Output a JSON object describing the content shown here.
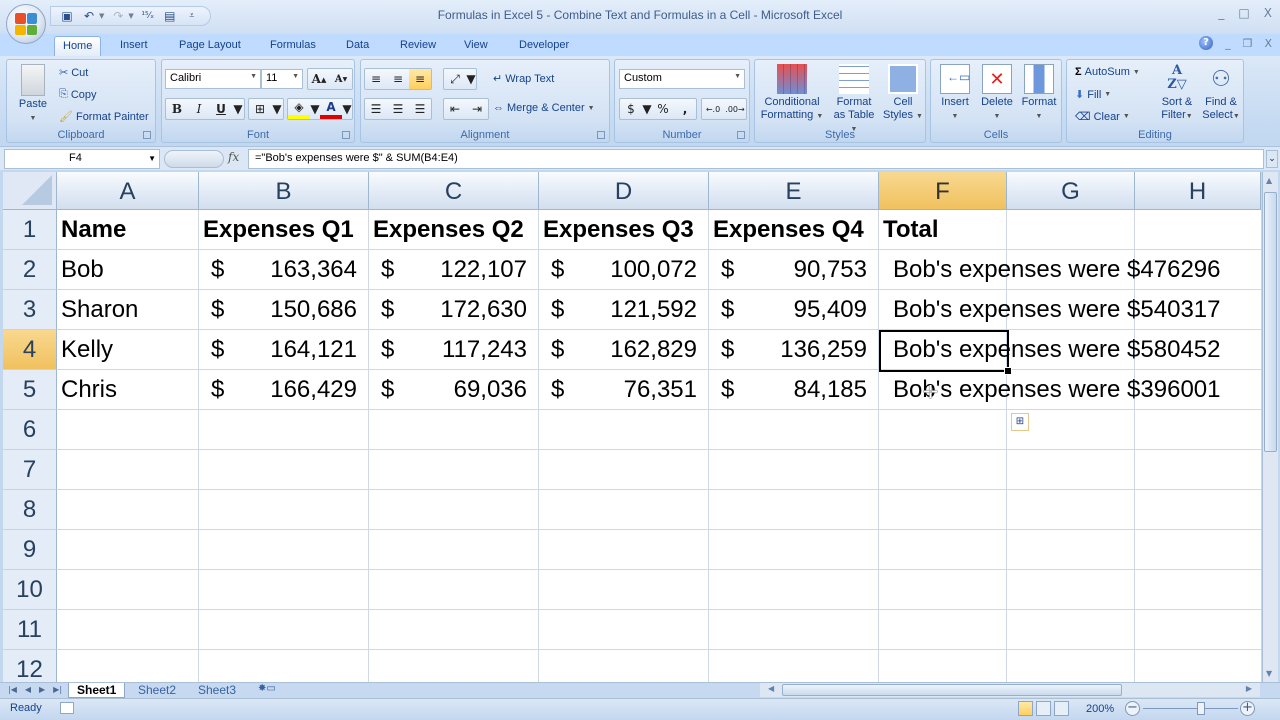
{
  "window": {
    "title": "Formulas in Excel 5 - Combine Text and Formulas in a Cell - Microsoft Excel",
    "controls": [
      "minimize",
      "maximize",
      "close"
    ]
  },
  "quick_access": [
    "save-icon",
    "undo-icon",
    "redo-icon",
    "spelling-icon",
    "print-preview-icon",
    "customize-icon"
  ],
  "tabs": [
    {
      "label": "Home",
      "active": true
    },
    {
      "label": "Insert"
    },
    {
      "label": "Page Layout"
    },
    {
      "label": "Formulas"
    },
    {
      "label": "Data"
    },
    {
      "label": "Review"
    },
    {
      "label": "View"
    },
    {
      "label": "Developer"
    }
  ],
  "ribbon": {
    "clipboard": {
      "label": "Clipboard",
      "paste": "Paste",
      "cut": "Cut",
      "copy": "Copy",
      "format_painter": "Format Painter"
    },
    "font": {
      "label": "Font",
      "font_name": "Calibri",
      "font_size": "11",
      "bold": "B",
      "italic": "I",
      "underline": "U"
    },
    "alignment": {
      "label": "Alignment",
      "wrap_text": "Wrap Text",
      "merge_center": "Merge & Center"
    },
    "number": {
      "label": "Number",
      "format": "Custom",
      "currency": "$",
      "percent": "%",
      "comma": ","
    },
    "styles": {
      "label": "Styles",
      "conditional": [
        "Conditional",
        "Formatting"
      ],
      "format_table": [
        "Format",
        "as Table"
      ],
      "cell_styles": [
        "Cell",
        "Styles"
      ]
    },
    "cells": {
      "label": "Cells",
      "insert": "Insert",
      "delete": "Delete",
      "format": "Format"
    },
    "editing": {
      "label": "Editing",
      "autosum": "AutoSum",
      "fill": "Fill",
      "clear": "Clear",
      "sort_filter": [
        "Sort &",
        "Filter"
      ],
      "find_select": [
        "Find &",
        "Select"
      ]
    }
  },
  "formula_bar": {
    "name_box": "F4",
    "fx": "fx",
    "formula": "=\"Bob's expenses were $\" & SUM(B4:E4)"
  },
  "sheet": {
    "columns": [
      "A",
      "B",
      "C",
      "D",
      "E",
      "F",
      "G",
      "H"
    ],
    "selected_column": "F",
    "rows": [
      "1",
      "2",
      "3",
      "4",
      "5",
      "6",
      "7",
      "8",
      "9",
      "10",
      "11",
      "12"
    ],
    "selected_row": "4",
    "active_cell": "F4",
    "headers": [
      "Name",
      "Expenses Q1",
      "Expenses Q2",
      "Expenses Q3",
      "Expenses Q4",
      "Total"
    ],
    "currency_symbol": "$",
    "data": [
      {
        "name": "Bob",
        "q1": "163,364",
        "q2": "122,107",
        "q3": "100,072",
        "q4": "90,753",
        "total": "Bob's expenses were $476296"
      },
      {
        "name": "Sharon",
        "q1": "150,686",
        "q2": "172,630",
        "q3": "121,592",
        "q4": "95,409",
        "total": "Bob's expenses were $540317"
      },
      {
        "name": "Kelly",
        "q1": "164,121",
        "q2": "117,243",
        "q3": "162,829",
        "q4": "136,259",
        "total": "Bob's expenses were $580452"
      },
      {
        "name": "Chris",
        "q1": "166,429",
        "q2": "69,036",
        "q3": "76,351",
        "q4": "84,185",
        "total": "Bob's expenses were $396001"
      }
    ]
  },
  "sheet_tabs": [
    {
      "label": "Sheet1",
      "active": true
    },
    {
      "label": "Sheet2"
    },
    {
      "label": "Sheet3"
    }
  ],
  "status": {
    "ready": "Ready",
    "zoom": "200%",
    "zoom_minus": "−",
    "zoom_plus": "+"
  }
}
